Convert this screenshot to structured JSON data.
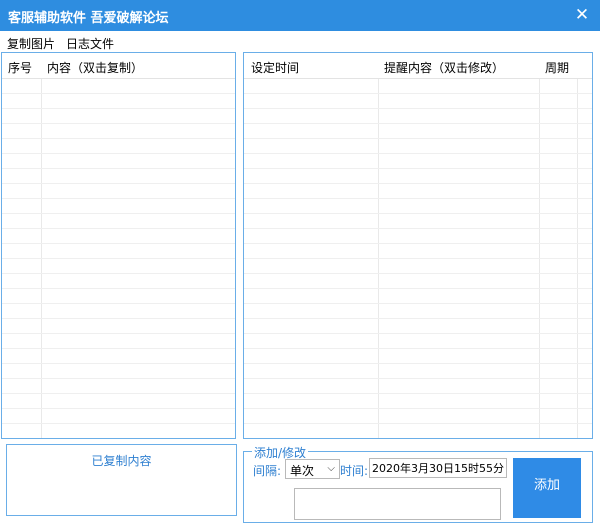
{
  "window": {
    "title": "客服辅助软件 吾爱破解论坛",
    "close_glyph": "✕"
  },
  "menu": {
    "items": [
      "复制图片",
      "日志文件"
    ]
  },
  "left_table": {
    "columns": [
      "序号",
      "内容（双击复制）"
    ],
    "rows": []
  },
  "right_table": {
    "columns": [
      "设定时间",
      "提醒内容（双击修改）",
      "周期"
    ],
    "rows": []
  },
  "copied": {
    "label": "已复制内容"
  },
  "add_edit": {
    "legend": "添加/修改",
    "interval_label": "间隔:",
    "interval_value": "单次",
    "time_label": "时间:",
    "time_value": "2020年3月30日15时55分",
    "content_value": "",
    "add_button": "添加"
  },
  "colors": {
    "titlebar": "#2e8de0",
    "accent_text": "#2e7fd0",
    "panel_border": "#6aaee8",
    "button": "#2f8be6"
  }
}
